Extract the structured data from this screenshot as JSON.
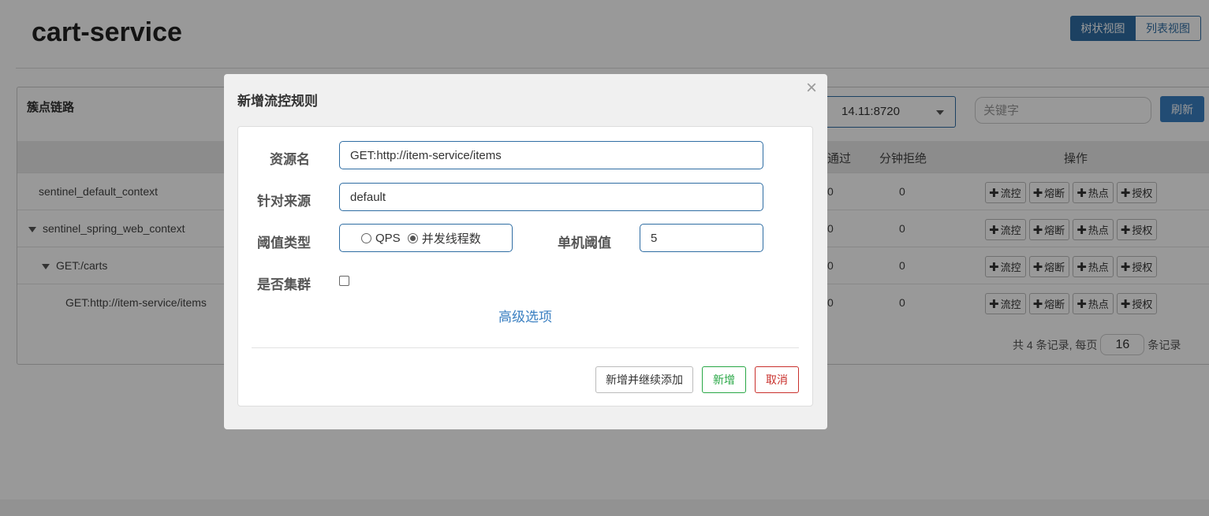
{
  "page": {
    "title": "cart-service",
    "view_tabs": [
      "树状视图",
      "列表视图"
    ]
  },
  "panel": {
    "heading": "簇点链路",
    "machine_select_value": "14.11:8720",
    "search_placeholder": "关键字",
    "refresh_label": "刷新",
    "columns": {
      "pass": "通过",
      "block": "分钟拒绝",
      "ops": "操作"
    },
    "rows": [
      {
        "name": "sentinel_default_context",
        "pass": "0",
        "block": "0",
        "expanded": false
      },
      {
        "name": "sentinel_spring_web_context",
        "pass": "0",
        "block": "0",
        "expanded": true
      },
      {
        "name": "GET:/carts",
        "pass": "0",
        "block": "0",
        "expanded": true
      },
      {
        "name": "GET:http://item-service/items",
        "pass": "0",
        "block": "0",
        "expanded": false
      }
    ],
    "op_buttons": [
      "流控",
      "熔断",
      "热点",
      "授权"
    ],
    "pager": {
      "prefix": "共 4 条记录, 每页",
      "page_size": "16",
      "suffix": "条记录"
    }
  },
  "modal": {
    "title": "新增流控规则",
    "fields": {
      "resource_label": "资源名",
      "resource_value": "GET:http://item-service/items",
      "origin_label": "针对来源",
      "origin_value": "default",
      "threshold_type_label": "阈值类型",
      "threshold_options": [
        "QPS",
        "并发线程数"
      ],
      "threshold_selected": "并发线程数",
      "single_threshold_label": "单机阈值",
      "single_threshold_value": "5",
      "cluster_label": "是否集群",
      "cluster_checked": false
    },
    "advanced_link": "高级选项",
    "buttons": {
      "add_continue": "新增并继续添加",
      "add": "新增",
      "cancel": "取消"
    }
  },
  "colors": {
    "primary": "#2f6da3",
    "success": "#28a745",
    "danger": "#c9302c",
    "link": "#3a7fc1"
  }
}
